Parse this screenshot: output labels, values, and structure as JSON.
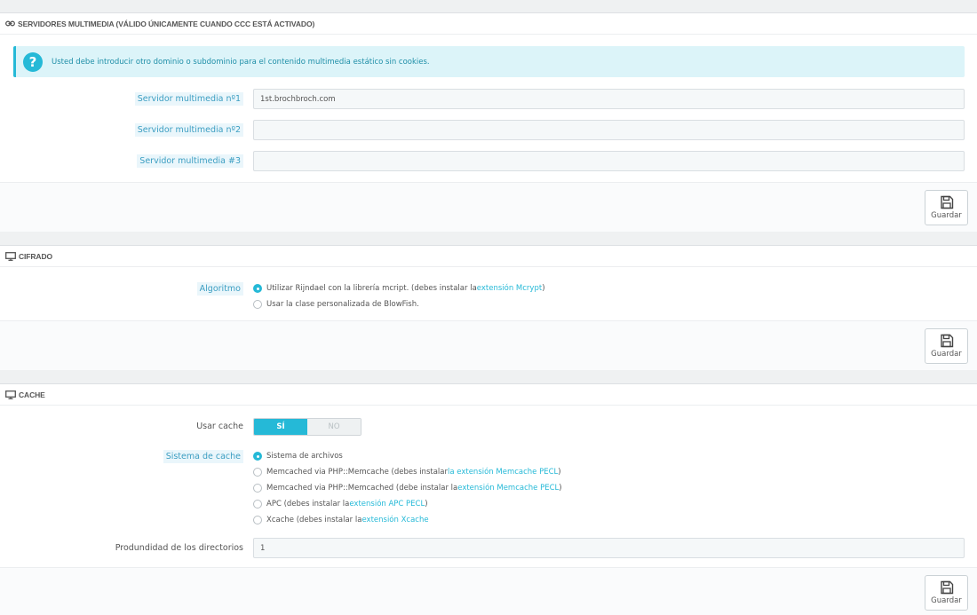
{
  "media_servers": {
    "title": "SERVIDORES MULTIMEDIA (VÁLIDO ÚNICAMENTE CUANDO CCC ESTÁ ACTIVADO)",
    "alert": "Usted debe introducir otro dominio o subdominio para el contenido multimedia estático sin cookies.",
    "fields": [
      {
        "label": "Servidor multimedia nº1",
        "value": "1st.brochbroch.com"
      },
      {
        "label": "Servidor multimedia nº2",
        "value": ""
      },
      {
        "label": "Servidor multimedia #3",
        "value": ""
      }
    ],
    "save_label": "Guardar"
  },
  "cipher": {
    "title": "CIFRADO",
    "algorithm_label": "Algoritmo",
    "options": [
      {
        "text": "Utilizar Rijndael con la librería mcript. (debes instalar la ",
        "link": "extensión Mcrypt",
        "after": ")",
        "selected": true
      },
      {
        "text": "Usar la clase personalizada de BlowFish.",
        "link": "",
        "after": "",
        "selected": false
      }
    ],
    "save_label": "Guardar"
  },
  "cache": {
    "title": "CACHE",
    "use_cache_label": "Usar cache",
    "toggle_yes": "SÍ",
    "toggle_no": "NO",
    "system_label": "Sistema de cache",
    "options": [
      {
        "text": "Sistema de archivos",
        "link": "",
        "after": "",
        "selected": true
      },
      {
        "text": "Memcached via PHP::Memcache (debes instalar ",
        "link": "la extensión Memcache PECL",
        "after": ")",
        "selected": false
      },
      {
        "text": "Memcached via PHP::Memcached (debe instalar la ",
        "link": "extensión Memcache PECL",
        "after": ")",
        "selected": false
      },
      {
        "text": "APC (debes instalar la ",
        "link": "extensión APC PECL",
        "after": ")",
        "selected": false
      },
      {
        "text": "Xcache (debes instalar la ",
        "link": "extensión Xcache",
        "after": "",
        "selected": false
      }
    ],
    "depth_label": "Produndidad de los directorios",
    "depth_value": "1",
    "save_label": "Guardar"
  },
  "icons": {
    "media": "link-icon",
    "cipher": "monitor-icon",
    "cache": "monitor-icon",
    "save": "floppy-disk-icon",
    "help": "question-icon"
  },
  "colors": {
    "accent": "#25b9d7",
    "alert_bg": "#dcf4f9"
  }
}
